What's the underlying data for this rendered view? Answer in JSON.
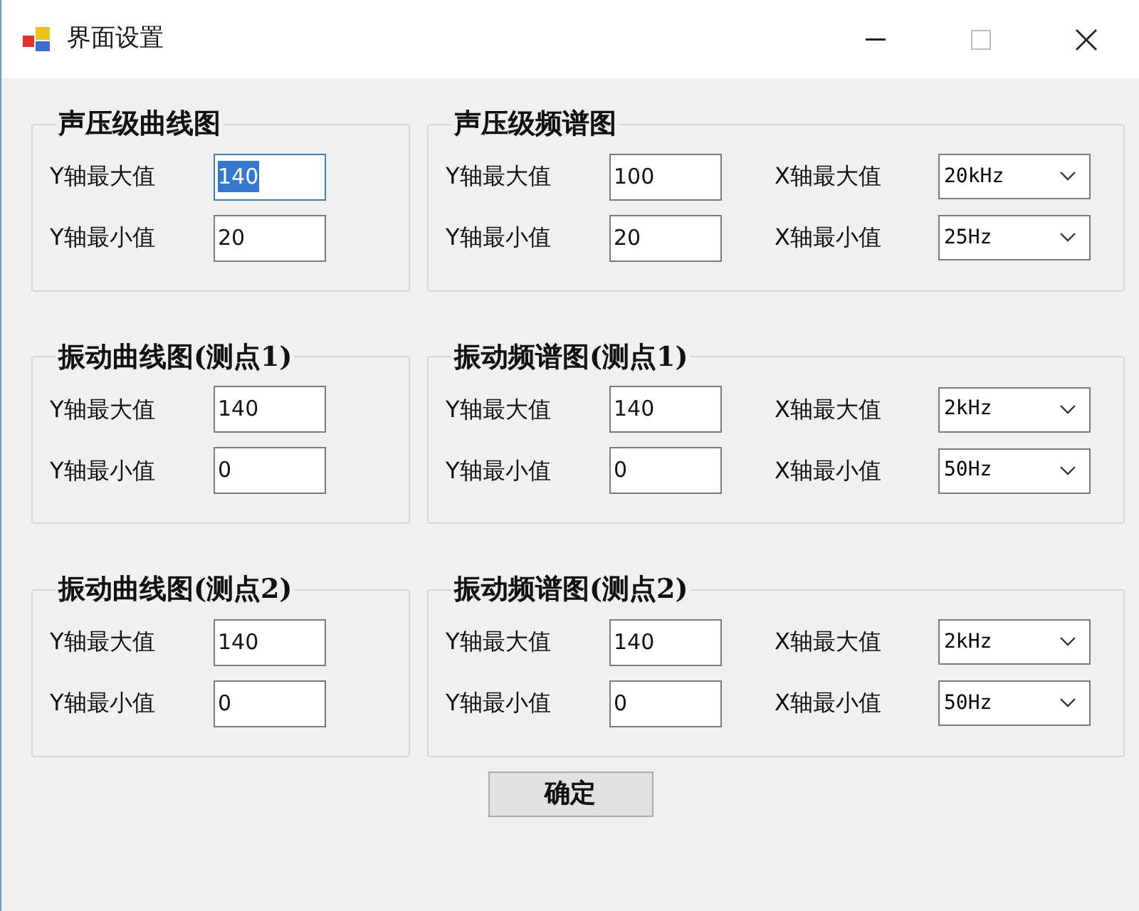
{
  "window": {
    "title": "界面设置"
  },
  "groups": [
    {
      "title": "声压级曲线图",
      "fields": [
        {
          "label": "Y轴最大值",
          "kind": "text",
          "value": "140",
          "focused": true
        },
        {
          "label": "Y轴最小值",
          "kind": "text",
          "value": "20",
          "focused": false
        }
      ]
    },
    {
      "title": "声压级频谱图",
      "fields": [
        {
          "label": "Y轴最大值",
          "kind": "text",
          "value": "100",
          "focused": false
        },
        {
          "label": "X轴最大值",
          "kind": "dropdown",
          "value": "20kHz",
          "focused": false
        },
        {
          "label": "Y轴最小值",
          "kind": "text",
          "value": "20",
          "focused": false
        },
        {
          "label": "X轴最小值",
          "kind": "dropdown",
          "value": "25Hz",
          "focused": false
        }
      ]
    },
    {
      "title": "振动曲线图(测点1)",
      "fields": [
        {
          "label": "Y轴最大值",
          "kind": "text",
          "value": "140",
          "focused": false
        },
        {
          "label": "Y轴最小值",
          "kind": "text",
          "value": "0",
          "focused": false
        }
      ]
    },
    {
      "title": "振动频谱图(测点1)",
      "fields": [
        {
          "label": "Y轴最大值",
          "kind": "text",
          "value": "140",
          "focused": false
        },
        {
          "label": "X轴最大值",
          "kind": "dropdown",
          "value": "2kHz",
          "focused": false
        },
        {
          "label": "Y轴最小值",
          "kind": "text",
          "value": "0",
          "focused": false
        },
        {
          "label": "X轴最小值",
          "kind": "dropdown",
          "value": "50Hz",
          "focused": false
        }
      ]
    },
    {
      "title": "振动曲线图(测点2)",
      "fields": [
        {
          "label": "Y轴最大值",
          "kind": "text",
          "value": "140",
          "focused": false
        },
        {
          "label": "Y轴最小值",
          "kind": "text",
          "value": "0",
          "focused": false
        }
      ]
    },
    {
      "title": "振动频谱图(测点2)",
      "fields": [
        {
          "label": "Y轴最大值",
          "kind": "text",
          "value": "140",
          "focused": false
        },
        {
          "label": "X轴最大值",
          "kind": "dropdown",
          "value": "2kHz",
          "focused": false
        },
        {
          "label": "Y轴最小值",
          "kind": "text",
          "value": "0",
          "focused": false
        },
        {
          "label": "X轴最小值",
          "kind": "dropdown",
          "value": "50Hz",
          "focused": false
        }
      ]
    }
  ],
  "button": "确定"
}
